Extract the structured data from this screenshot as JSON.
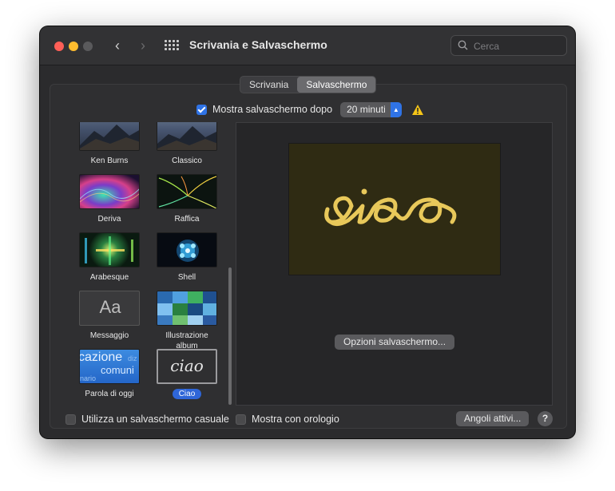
{
  "window": {
    "title": "Scrivania e Salvaschermo",
    "search_placeholder": "Cerca"
  },
  "tabs": [
    {
      "label": "Scrivania",
      "active": false
    },
    {
      "label": "Salvaschermo",
      "active": true
    }
  ],
  "show_after": {
    "checked": true,
    "label": "Mostra salvaschermo dopo",
    "value": "20 minuti"
  },
  "screensavers": [
    {
      "label": "Ken Burns",
      "icon": "mountain-landscape"
    },
    {
      "label": "Classico",
      "icon": "mountain-landscape"
    },
    {
      "label": "Deriva",
      "icon": "colorful-waves"
    },
    {
      "label": "Raffica",
      "icon": "light-rays"
    },
    {
      "label": "Arabesque",
      "icon": "color-bars"
    },
    {
      "label": "Shell",
      "icon": "blue-shell"
    },
    {
      "label": "Messaggio",
      "icon": "aa-text",
      "thumb_text": "Aa"
    },
    {
      "label": "Illustrazione album",
      "icon": "album-mosaic"
    },
    {
      "label": "Parola di oggi",
      "icon": "word-of-day",
      "thumb_text": "cazione",
      "thumb_text2": "comuni",
      "thumb_text3": "nario",
      "thumb_text4": "diz"
    },
    {
      "label": "Ciao",
      "icon": "ciao-script",
      "thumb_text": "ciao",
      "selected": true
    }
  ],
  "preview": {
    "text": "ciao",
    "colors": {
      "background": "#2f2b13",
      "text": "#e8c85a"
    }
  },
  "options_button": "Opzioni salvaschermo...",
  "random": {
    "checked": false,
    "label": "Utilizza un salvaschermo casuale"
  },
  "clock": {
    "checked": false,
    "label": "Mostra con orologio"
  },
  "hot_corners_button": "Angoli attivi...",
  "help_label": "?"
}
